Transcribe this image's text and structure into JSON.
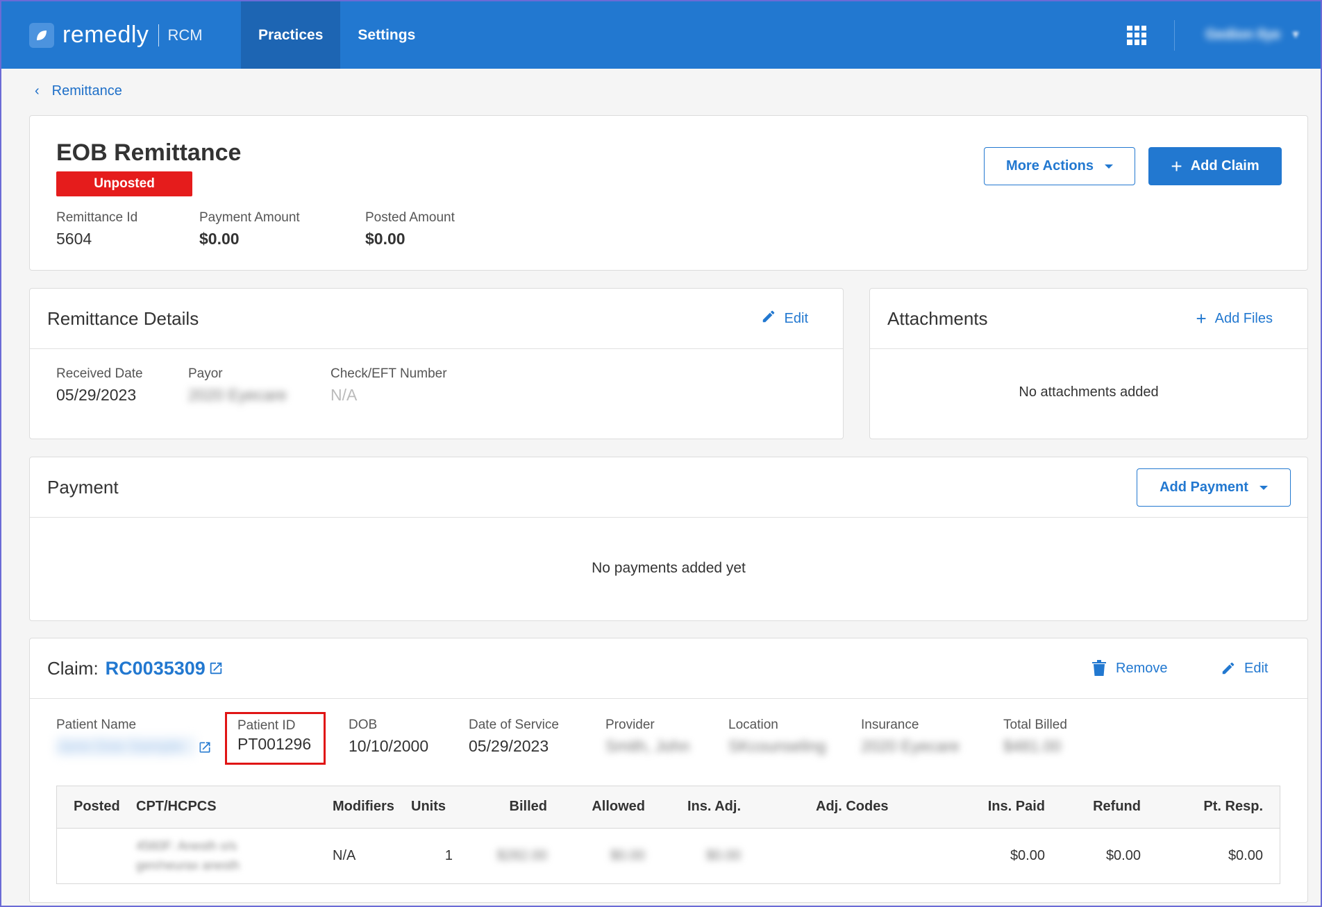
{
  "header": {
    "logo_text": "remedly",
    "logo_sub": "RCM",
    "nav": [
      "Practices",
      "Settings"
    ],
    "user_name": "Gedion Ilye"
  },
  "breadcrumb": {
    "back_label": "Remittance"
  },
  "summary": {
    "title": "EOB Remittance",
    "status": "Unposted",
    "more_actions": "More Actions",
    "add_claim": "Add Claim",
    "fields": [
      {
        "label": "Remittance Id",
        "value": "5604"
      },
      {
        "label": "Payment Amount",
        "value": "$0.00"
      },
      {
        "label": "Posted Amount",
        "value": "$0.00"
      }
    ]
  },
  "remittance_details": {
    "title": "Remittance Details",
    "edit": "Edit",
    "fields": [
      {
        "label": "Received Date",
        "value": "05/29/2023"
      },
      {
        "label": "Payor",
        "value": "2020 Eyecare"
      },
      {
        "label": "Check/EFT Number",
        "value": "N/A"
      }
    ]
  },
  "attachments": {
    "title": "Attachments",
    "add_files": "Add Files",
    "empty": "No attachments added"
  },
  "payment": {
    "title": "Payment",
    "add_payment": "Add Payment",
    "empty": "No payments added yet"
  },
  "claim": {
    "title_prefix": "Claim:",
    "claim_id": "RC0035309",
    "remove": "Remove",
    "edit": "Edit",
    "fields": [
      {
        "label": "Patient Name",
        "value": "Jane Doe Sample"
      },
      {
        "label": "Patient ID",
        "value": "PT001296"
      },
      {
        "label": "DOB",
        "value": "10/10/2000"
      },
      {
        "label": "Date of Service",
        "value": "05/29/2023"
      },
      {
        "label": "Provider",
        "value": "Smith, John"
      },
      {
        "label": "Location",
        "value": "SKcounseling"
      },
      {
        "label": "Insurance",
        "value": "2020 Eyecare"
      },
      {
        "label": "Total Billed",
        "value": "$481.00"
      }
    ],
    "table": {
      "headers": [
        "Posted",
        "CPT/HCPCS",
        "Modifiers",
        "Units",
        "Billed",
        "Allowed",
        "Ins. Adj.",
        "Adj. Codes",
        "Ins. Paid",
        "Refund",
        "Pt. Resp."
      ],
      "rows": [
        {
          "posted": "",
          "cpt_line1": "4560F: Anesth o/s",
          "cpt_line2": "gen/neurax anesth",
          "modifiers": "N/A",
          "units": "1",
          "billed": "$282.00",
          "allowed": "$0.00",
          "ins_adj": "$0.00",
          "adj_codes": "",
          "ins_paid": "$0.00",
          "refund": "$0.00",
          "pt_resp": "$0.00"
        }
      ]
    }
  }
}
